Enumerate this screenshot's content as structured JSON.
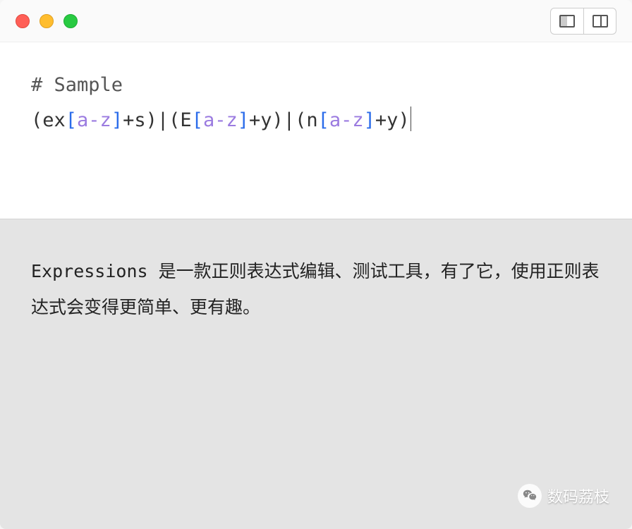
{
  "editor": {
    "comment": "# Sample",
    "pattern": {
      "full": "(ex[a-z]+s)|(E[a-z]+y)|(n[a-z]+y)",
      "groups": [
        {
          "prefix": "ex",
          "range": "a-z",
          "suffix": "s"
        },
        {
          "prefix": "E",
          "range": "a-z",
          "suffix": "y"
        },
        {
          "prefix": "n",
          "range": "a-z",
          "suffix": "y"
        }
      ]
    }
  },
  "output": {
    "text": "Expressions 是一款正则表达式编辑、测试工具，有了它，使用正则表达式会变得更简单、更有趣。"
  },
  "watermark": {
    "label": "数码荔枝"
  },
  "syntax_colors": {
    "bracket": "#2b6cea",
    "range": "#9b7be0",
    "default": "#333"
  }
}
